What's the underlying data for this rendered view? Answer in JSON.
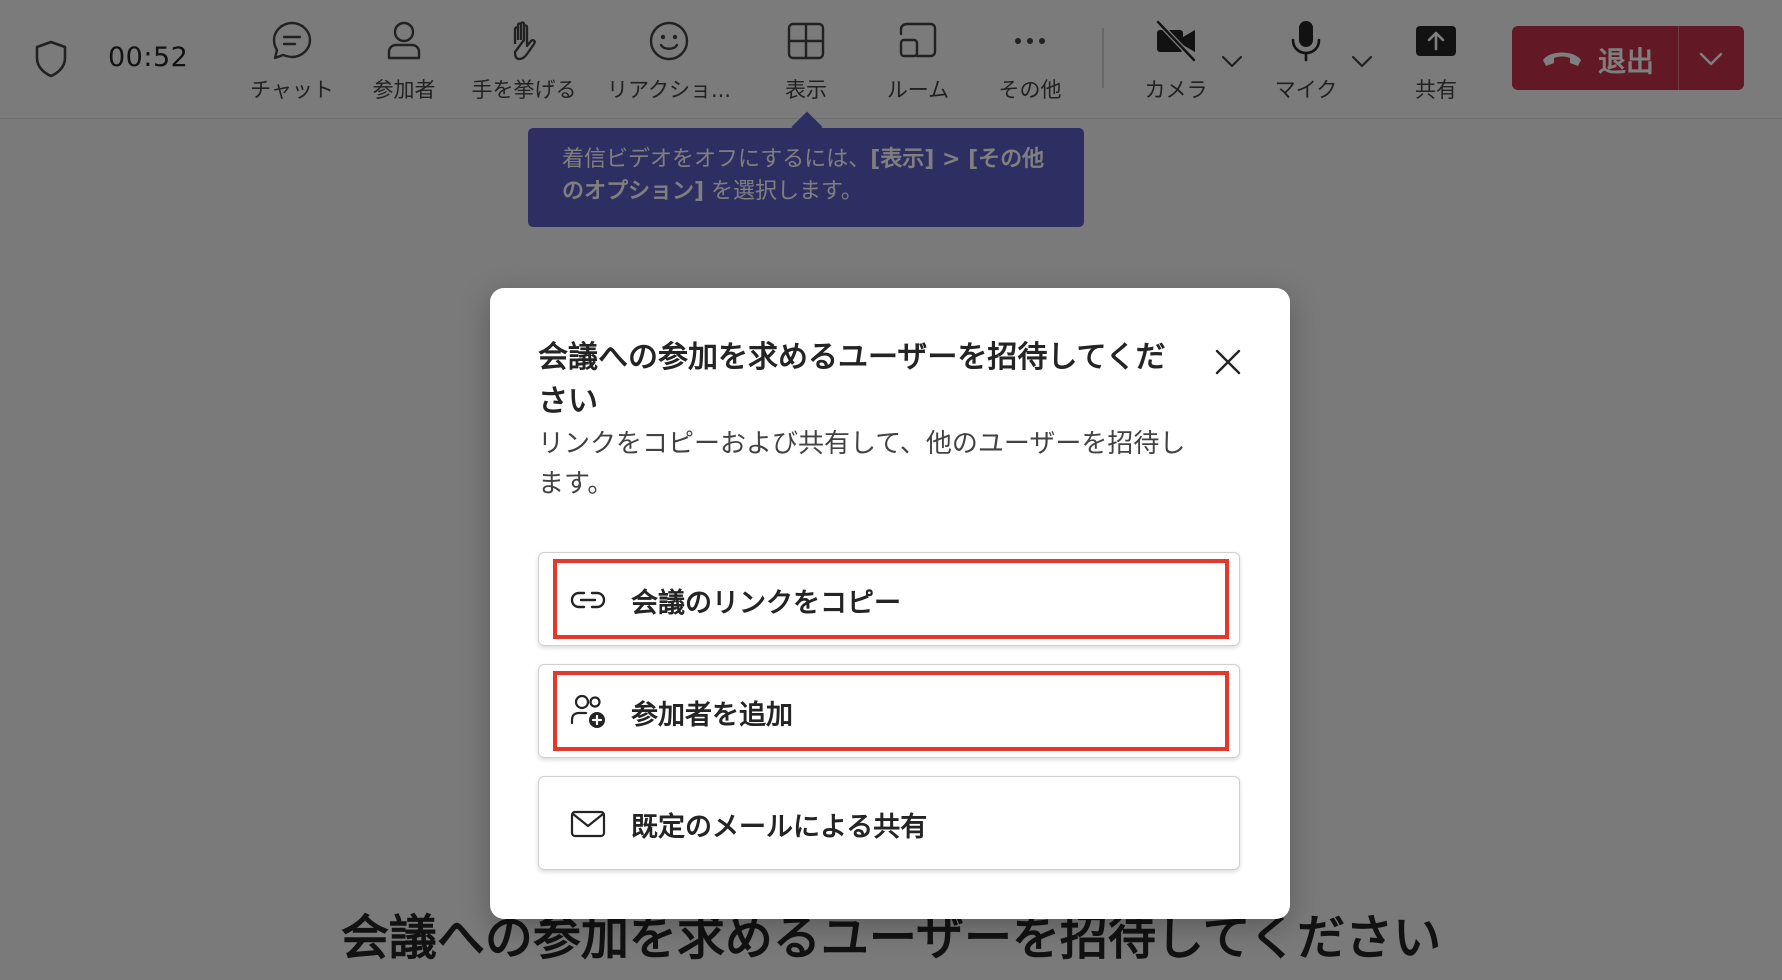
{
  "toolbar": {
    "timer": "00:52",
    "items": [
      {
        "label": "チャット",
        "icon": "chat-icon"
      },
      {
        "label": "参加者",
        "icon": "people-icon"
      },
      {
        "label": "手を挙げる",
        "icon": "raise-hand-icon"
      },
      {
        "label": "リアクショ...",
        "icon": "smiley-icon"
      },
      {
        "label": "表示",
        "icon": "view-grid-icon"
      },
      {
        "label": "ルーム",
        "icon": "rooms-icon"
      },
      {
        "label": "その他",
        "icon": "more-icon"
      },
      {
        "label": "カメラ",
        "icon": "camera-off-icon"
      },
      {
        "label": "マイク",
        "icon": "microphone-icon"
      },
      {
        "label": "共有",
        "icon": "share-icon"
      }
    ],
    "leave_label": "退出"
  },
  "tooltip": {
    "text_before": "着信ビデオをオフにするには、",
    "bold1": "[表示] > [その他のオプション]",
    "text_after": " を選択します。"
  },
  "dialog": {
    "title": "会議への参加を求めるユーザーを招待してください",
    "description": "リンクをコピーおよび共有して、他のユーザーを招待します。",
    "options": [
      {
        "label": "会議のリンクをコピー",
        "icon": "link-icon",
        "highlighted": true
      },
      {
        "label": "参加者を追加",
        "icon": "add-person-icon",
        "highlighted": true
      },
      {
        "label": "既定のメールによる共有",
        "icon": "mail-icon",
        "highlighted": false
      }
    ]
  },
  "background": {
    "heading": "会議への参加を求めるユーザーを招待してください"
  },
  "colors": {
    "accent": "#5b5fc7",
    "leave": "#c4314b",
    "highlight": "#e5372a"
  }
}
